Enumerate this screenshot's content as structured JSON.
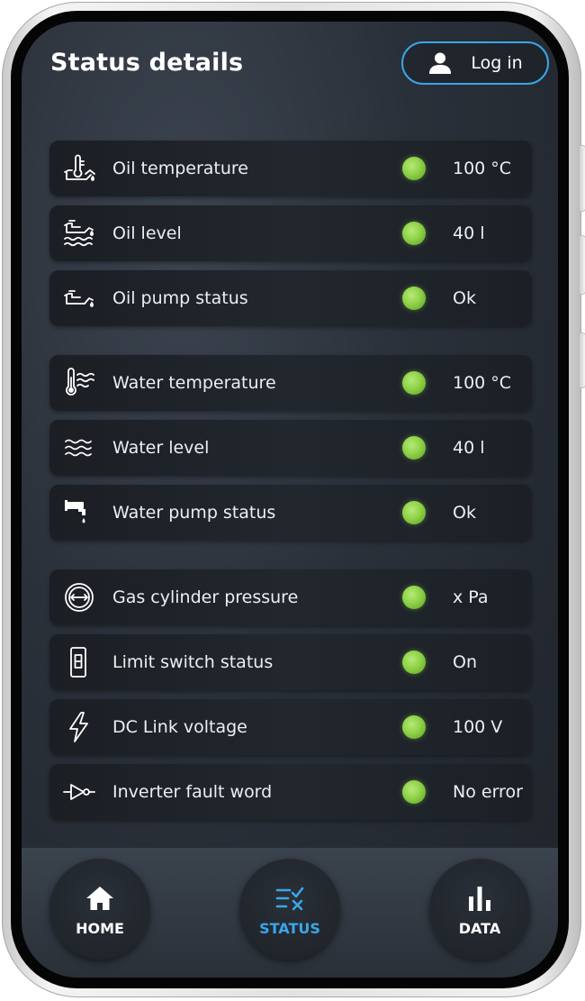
{
  "header": {
    "title": "Status details",
    "login_label": "Log in"
  },
  "colors": {
    "accent": "#38a6e8",
    "status_ok": "#8fd248",
    "row_background": "#1e2228"
  },
  "status_items": [
    {
      "icon": "oil-temperature-icon",
      "label": "Oil temperature",
      "status": "ok",
      "value": "100 °C"
    },
    {
      "icon": "oil-level-icon",
      "label": "Oil level",
      "status": "ok",
      "value": "40 l"
    },
    {
      "icon": "oil-pump-icon",
      "label": "Oil pump status",
      "status": "ok",
      "value": "Ok"
    },
    {
      "icon": "water-temperature-icon",
      "label": "Water temperature",
      "status": "ok",
      "value": "100 °C"
    },
    {
      "icon": "water-level-icon",
      "label": "Water level",
      "status": "ok",
      "value": "40 l"
    },
    {
      "icon": "water-pump-icon",
      "label": "Water pump status",
      "status": "ok",
      "value": "Ok"
    },
    {
      "icon": "gas-pressure-icon",
      "label": "Gas cylinder pressure",
      "status": "ok",
      "value": "x Pa"
    },
    {
      "icon": "limit-switch-icon",
      "label": "Limit switch status",
      "status": "ok",
      "value": "On"
    },
    {
      "icon": "lightning-icon",
      "label": "DC Link voltage",
      "status": "ok",
      "value": "100 V"
    },
    {
      "icon": "inverter-icon",
      "label": "Inverter fault word",
      "status": "ok",
      "value": "No error"
    }
  ],
  "nav": {
    "home_label": "HOME",
    "status_label": "STATUS",
    "data_label": "DATA",
    "active": "status"
  }
}
